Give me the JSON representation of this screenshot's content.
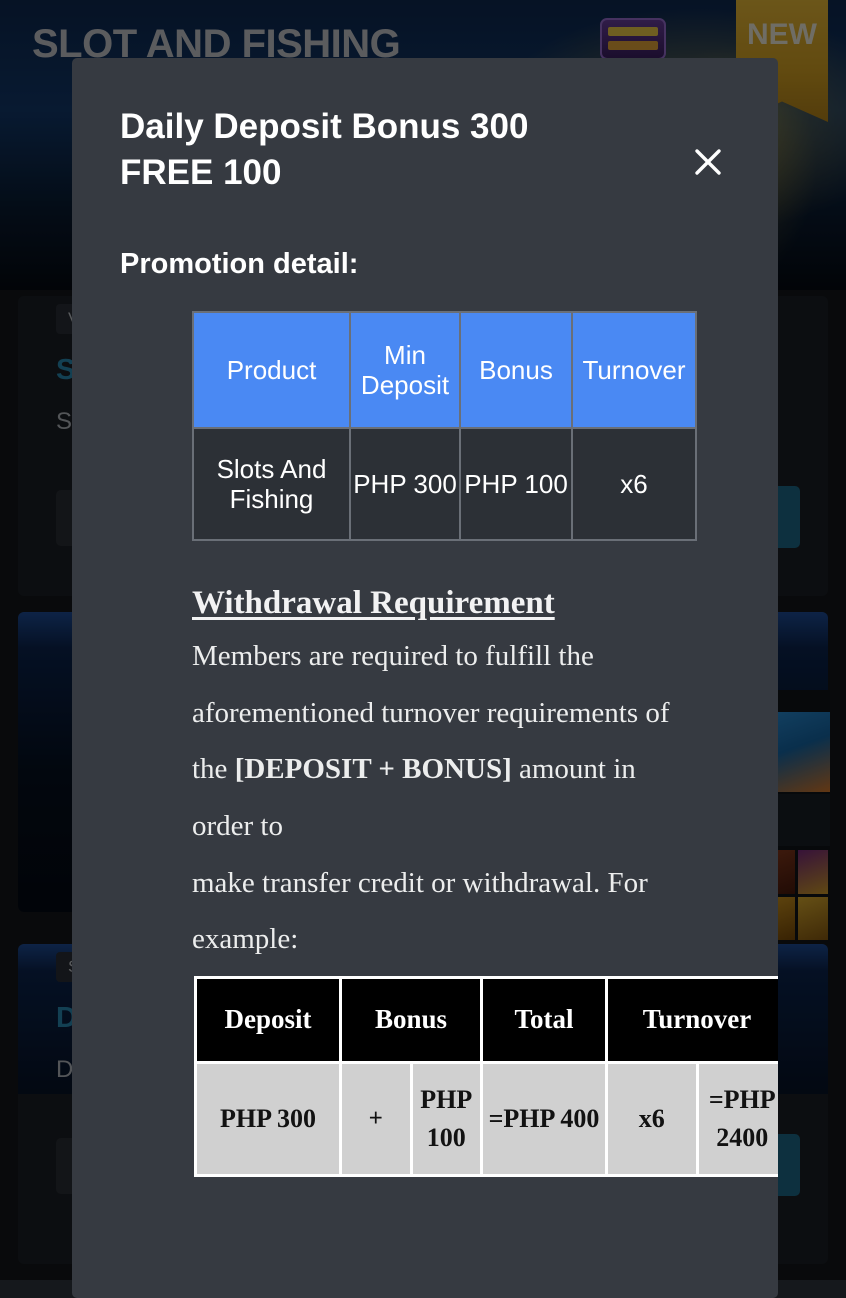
{
  "background": {
    "hero": {
      "title": "SLOT AND FISHING",
      "new_badge": "NEW"
    },
    "cards": [
      {
        "badge": "V",
        "title": "Slo",
        "desc": "Slo"
      },
      {
        "badge": "",
        "title": "",
        "desc": ""
      },
      {
        "badge": "Sl",
        "title": "Da",
        "desc": "Da"
      }
    ]
  },
  "modal": {
    "title": "Daily Deposit Bonus 300\nFREE 100",
    "close_icon": "close-icon",
    "promo_detail_label": "Promotion detail:",
    "promo_table": {
      "headers": [
        "Product",
        "Min Deposit",
        "Bonus",
        "Turnover"
      ],
      "rows": [
        [
          "Slots And Fishing",
          "PHP 300",
          "PHP 100",
          "x6"
        ]
      ],
      "header_color": "#4a89f3",
      "body_color": "#2c3036"
    },
    "withdrawal": {
      "heading": "Withdrawal Requirement",
      "line1": "Members are required to fulfill the",
      "line2": "aforementioned turnover requirements of",
      "line3_pre": "the ",
      "line3_bold": "[DEPOSIT + BONUS]",
      "line3_post": " amount in",
      "line4": "order to",
      "line5": "make transfer credit or withdrawal. For",
      "line6": "example:"
    },
    "example_table": {
      "headers": [
        "Deposit",
        "Bonus",
        "Total",
        "Turnover"
      ],
      "cells": [
        "PHP 300",
        "+",
        "PHP 100",
        "=PHP 400",
        "x6",
        "=PHP 2400"
      ],
      "header_color": "#000000",
      "body_color": "#d0d0d0"
    }
  }
}
